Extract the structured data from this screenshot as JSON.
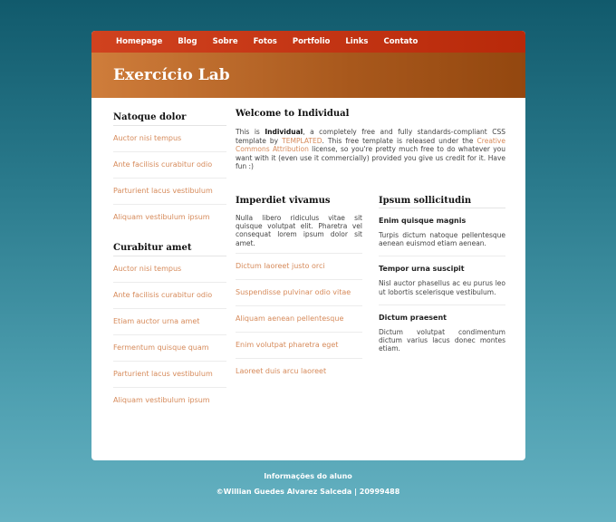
{
  "nav": {
    "items": [
      "Homepage",
      "Blog",
      "Sobre",
      "Fotos",
      "Portfolio",
      "Links",
      "Contato"
    ]
  },
  "header": {
    "title": "Exercício Lab"
  },
  "sidebar": {
    "block1": {
      "title": "Natoque dolor",
      "links": [
        "Auctor nisi tempus",
        "Ante facilisis curabitur odio",
        "Parturient lacus vestibulum",
        "Aliquam vestibulum ipsum"
      ]
    },
    "block2": {
      "title": "Curabitur amet",
      "links": [
        "Auctor nisi tempus",
        "Ante facilisis curabitur odio",
        "Etiam auctor urna amet",
        "Fermentum quisque quam",
        "Parturient lacus vestibulum",
        "Aliquam vestibulum ipsum"
      ]
    }
  },
  "main": {
    "title": "Welcome to Individual",
    "intro": {
      "t1": "This is ",
      "b1": "Individual",
      "t2": ", a completely free and fully standards-compliant CSS template by ",
      "link1": "TEMPLATED",
      "t3": ". This free template is released under the ",
      "link2": "Creative Commons Attribution",
      "t4": " license, so you're pretty much free to do whatever you want with it (even use it commercially) provided you give us credit for it. Have fun :)"
    },
    "left": {
      "title": "Imperdiet vivamus",
      "text": "Nulla libero ridiculus vitae sit quisque volutpat elit. Pharetra vel consequat lorem ipsum dolor sit amet.",
      "links": [
        "Dictum laoreet justo orci",
        "Suspendisse pulvinar odio vitae",
        "Aliquam aenean pellentesque",
        "Enim volutpat pharetra eget",
        "Laoreet duis arcu laoreet"
      ]
    },
    "right": {
      "title": "Ipsum sollicitudin",
      "sections": [
        {
          "title": "Enim quisque magnis",
          "text": "Turpis dictum natoque pellentesque aenean euismod etiam aenean."
        },
        {
          "title": "Tempor urna suscipit",
          "text": "Nisl auctor phasellus ac eu purus leo ut lobortis scelerisque vestibulum."
        },
        {
          "title": "Dictum praesent",
          "text": "Dictum volutpat condimentum dictum varius lacus donec montes etiam."
        }
      ]
    }
  },
  "footer": {
    "line1": "Informações do aluno",
    "line2": "©Willian Guedes Alvarez Salceda | 20999488"
  }
}
